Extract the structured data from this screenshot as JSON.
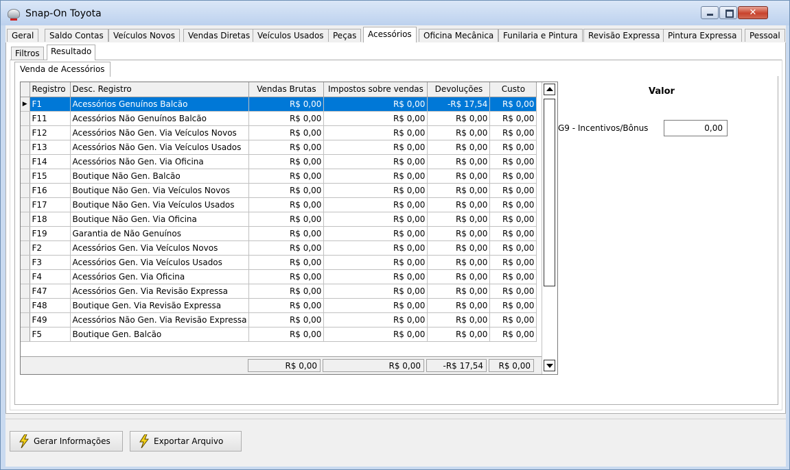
{
  "window": {
    "title": "Snap-On Toyota",
    "minimize_glyph": "",
    "maximize_glyph": "",
    "close_glyph": "✕"
  },
  "main_tabs": [
    {
      "label": "Geral"
    },
    {
      "label": "Saldo Contas"
    },
    {
      "label": "Veículos Novos"
    },
    {
      "label": "Vendas Diretas"
    },
    {
      "label": "Veículos Usados"
    },
    {
      "label": "Peças"
    },
    {
      "label": "Acessórios",
      "active": true
    },
    {
      "label": "Oficina Mecânica"
    },
    {
      "label": "Funilaria e Pintura"
    },
    {
      "label": "Revisão Expressa"
    },
    {
      "label": "Pintura Expressa"
    },
    {
      "label": "Pessoal"
    }
  ],
  "sub_tabs": [
    {
      "label": "Filtros"
    },
    {
      "label": "Resultado",
      "active": true
    }
  ],
  "inner_tab": {
    "label": "Venda de Acessórios"
  },
  "grid": {
    "columns": [
      "Registro",
      "Desc. Registro",
      "Vendas Brutas",
      "Impostos sobre vendas",
      "Devoluções",
      "Custo"
    ],
    "current_row_indicator": "▶",
    "rows": [
      {
        "registro": "F1",
        "desc": "Acessórios Genuínos Balcão",
        "vendas": "R$ 0,00",
        "impostos": "R$ 0,00",
        "devolucoes": "-R$ 17,54",
        "custo": "R$ 0,00",
        "selected": true
      },
      {
        "registro": "F11",
        "desc": "Acessórios Não Genuínos Balcão",
        "vendas": "R$ 0,00",
        "impostos": "R$ 0,00",
        "devolucoes": "R$ 0,00",
        "custo": "R$ 0,00"
      },
      {
        "registro": "F12",
        "desc": "Acessórios Não Gen. Via Veículos Novos",
        "vendas": "R$ 0,00",
        "impostos": "R$ 0,00",
        "devolucoes": "R$ 0,00",
        "custo": "R$ 0,00"
      },
      {
        "registro": "F13",
        "desc": "Acessórios Não Gen. Via Veículos Usados",
        "vendas": "R$ 0,00",
        "impostos": "R$ 0,00",
        "devolucoes": "R$ 0,00",
        "custo": "R$ 0,00"
      },
      {
        "registro": "F14",
        "desc": "Acessórios Não Gen. Via Oficina",
        "vendas": "R$ 0,00",
        "impostos": "R$ 0,00",
        "devolucoes": "R$ 0,00",
        "custo": "R$ 0,00"
      },
      {
        "registro": "F15",
        "desc": "Boutique Não Gen. Balcão",
        "vendas": "R$ 0,00",
        "impostos": "R$ 0,00",
        "devolucoes": "R$ 0,00",
        "custo": "R$ 0,00"
      },
      {
        "registro": "F16",
        "desc": "Boutique Não Gen. Via Veículos Novos",
        "vendas": "R$ 0,00",
        "impostos": "R$ 0,00",
        "devolucoes": "R$ 0,00",
        "custo": "R$ 0,00"
      },
      {
        "registro": "F17",
        "desc": "Boutique Não Gen. Via Veículos Usados",
        "vendas": "R$ 0,00",
        "impostos": "R$ 0,00",
        "devolucoes": "R$ 0,00",
        "custo": "R$ 0,00"
      },
      {
        "registro": "F18",
        "desc": "Boutique Não Gen. Via Oficina",
        "vendas": "R$ 0,00",
        "impostos": "R$ 0,00",
        "devolucoes": "R$ 0,00",
        "custo": "R$ 0,00"
      },
      {
        "registro": "F19",
        "desc": "Garantia de Não Genuínos",
        "vendas": "R$ 0,00",
        "impostos": "R$ 0,00",
        "devolucoes": "R$ 0,00",
        "custo": "R$ 0,00"
      },
      {
        "registro": "F2",
        "desc": "Acessórios Gen. Via Veículos Novos",
        "vendas": "R$ 0,00",
        "impostos": "R$ 0,00",
        "devolucoes": "R$ 0,00",
        "custo": "R$ 0,00"
      },
      {
        "registro": "F3",
        "desc": "Acessórios Gen. Via Veículos Usados",
        "vendas": "R$ 0,00",
        "impostos": "R$ 0,00",
        "devolucoes": "R$ 0,00",
        "custo": "R$ 0,00"
      },
      {
        "registro": "F4",
        "desc": "Acessórios Gen. Via Oficina",
        "vendas": "R$ 0,00",
        "impostos": "R$ 0,00",
        "devolucoes": "R$ 0,00",
        "custo": "R$ 0,00"
      },
      {
        "registro": "F47",
        "desc": "Acessórios Gen. Via Revisão Expressa",
        "vendas": "R$ 0,00",
        "impostos": "R$ 0,00",
        "devolucoes": "R$ 0,00",
        "custo": "R$ 0,00"
      },
      {
        "registro": "F48",
        "desc": "Boutique Gen. Via Revisão Expressa",
        "vendas": "R$ 0,00",
        "impostos": "R$ 0,00",
        "devolucoes": "R$ 0,00",
        "custo": "R$ 0,00"
      },
      {
        "registro": "F49",
        "desc": "Acessórios Não Gen. Via Revisão Expressa",
        "vendas": "R$ 0,00",
        "impostos": "R$ 0,00",
        "devolucoes": "R$ 0,00",
        "custo": "R$ 0,00"
      },
      {
        "registro": "F5",
        "desc": "Boutique Gen. Balcão",
        "vendas": "R$ 0,00",
        "impostos": "R$ 0,00",
        "devolucoes": "R$ 0,00",
        "custo": "R$ 0,00"
      }
    ],
    "totals": {
      "vendas": "R$ 0,00",
      "impostos": "R$ 0,00",
      "devolucoes": "-R$ 17,54",
      "custo": "R$ 0,00"
    }
  },
  "right_panel": {
    "valor_header": "Valor",
    "g9_label": "G9 - Incentivos/Bônus",
    "g9_value": "0,00"
  },
  "buttons": {
    "gerar_label": "Gerar Informações",
    "exportar_label": "Exportar Arquivo"
  },
  "colors": {
    "selection": "#0078d7",
    "bolt_fill": "#f5d31a",
    "bolt_stroke": "#5a4500"
  }
}
